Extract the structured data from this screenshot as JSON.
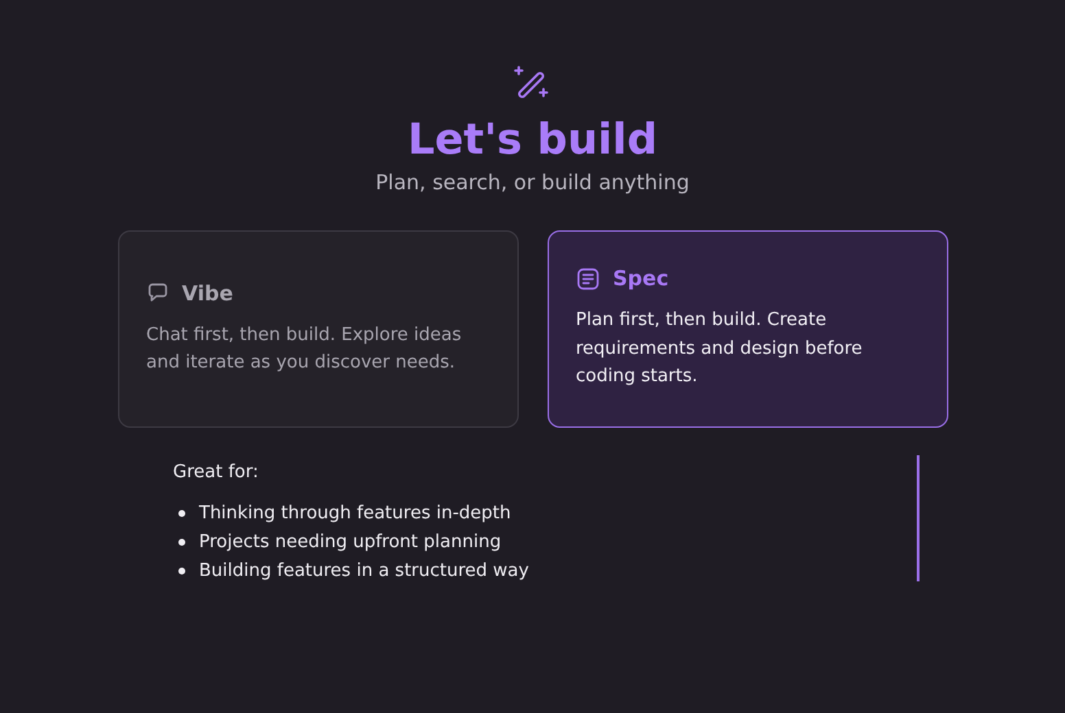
{
  "header": {
    "title": "Let's build",
    "subtitle": "Plan, search, or build anything"
  },
  "modes": [
    {
      "kind": "chat",
      "label": "Vibe",
      "description": "Chat first, then build. Explore ideas and iterate as you discover needs.",
      "selected": false
    },
    {
      "kind": "spec",
      "label": "Spec",
      "description": "Plan first, then build. Create requirements and design before coding starts.",
      "selected": true
    }
  ],
  "details": {
    "heading": "Great for:",
    "items": [
      "Thinking through features in-depth",
      "Projects needing upfront planning",
      "Building features in a structured way"
    ]
  }
}
